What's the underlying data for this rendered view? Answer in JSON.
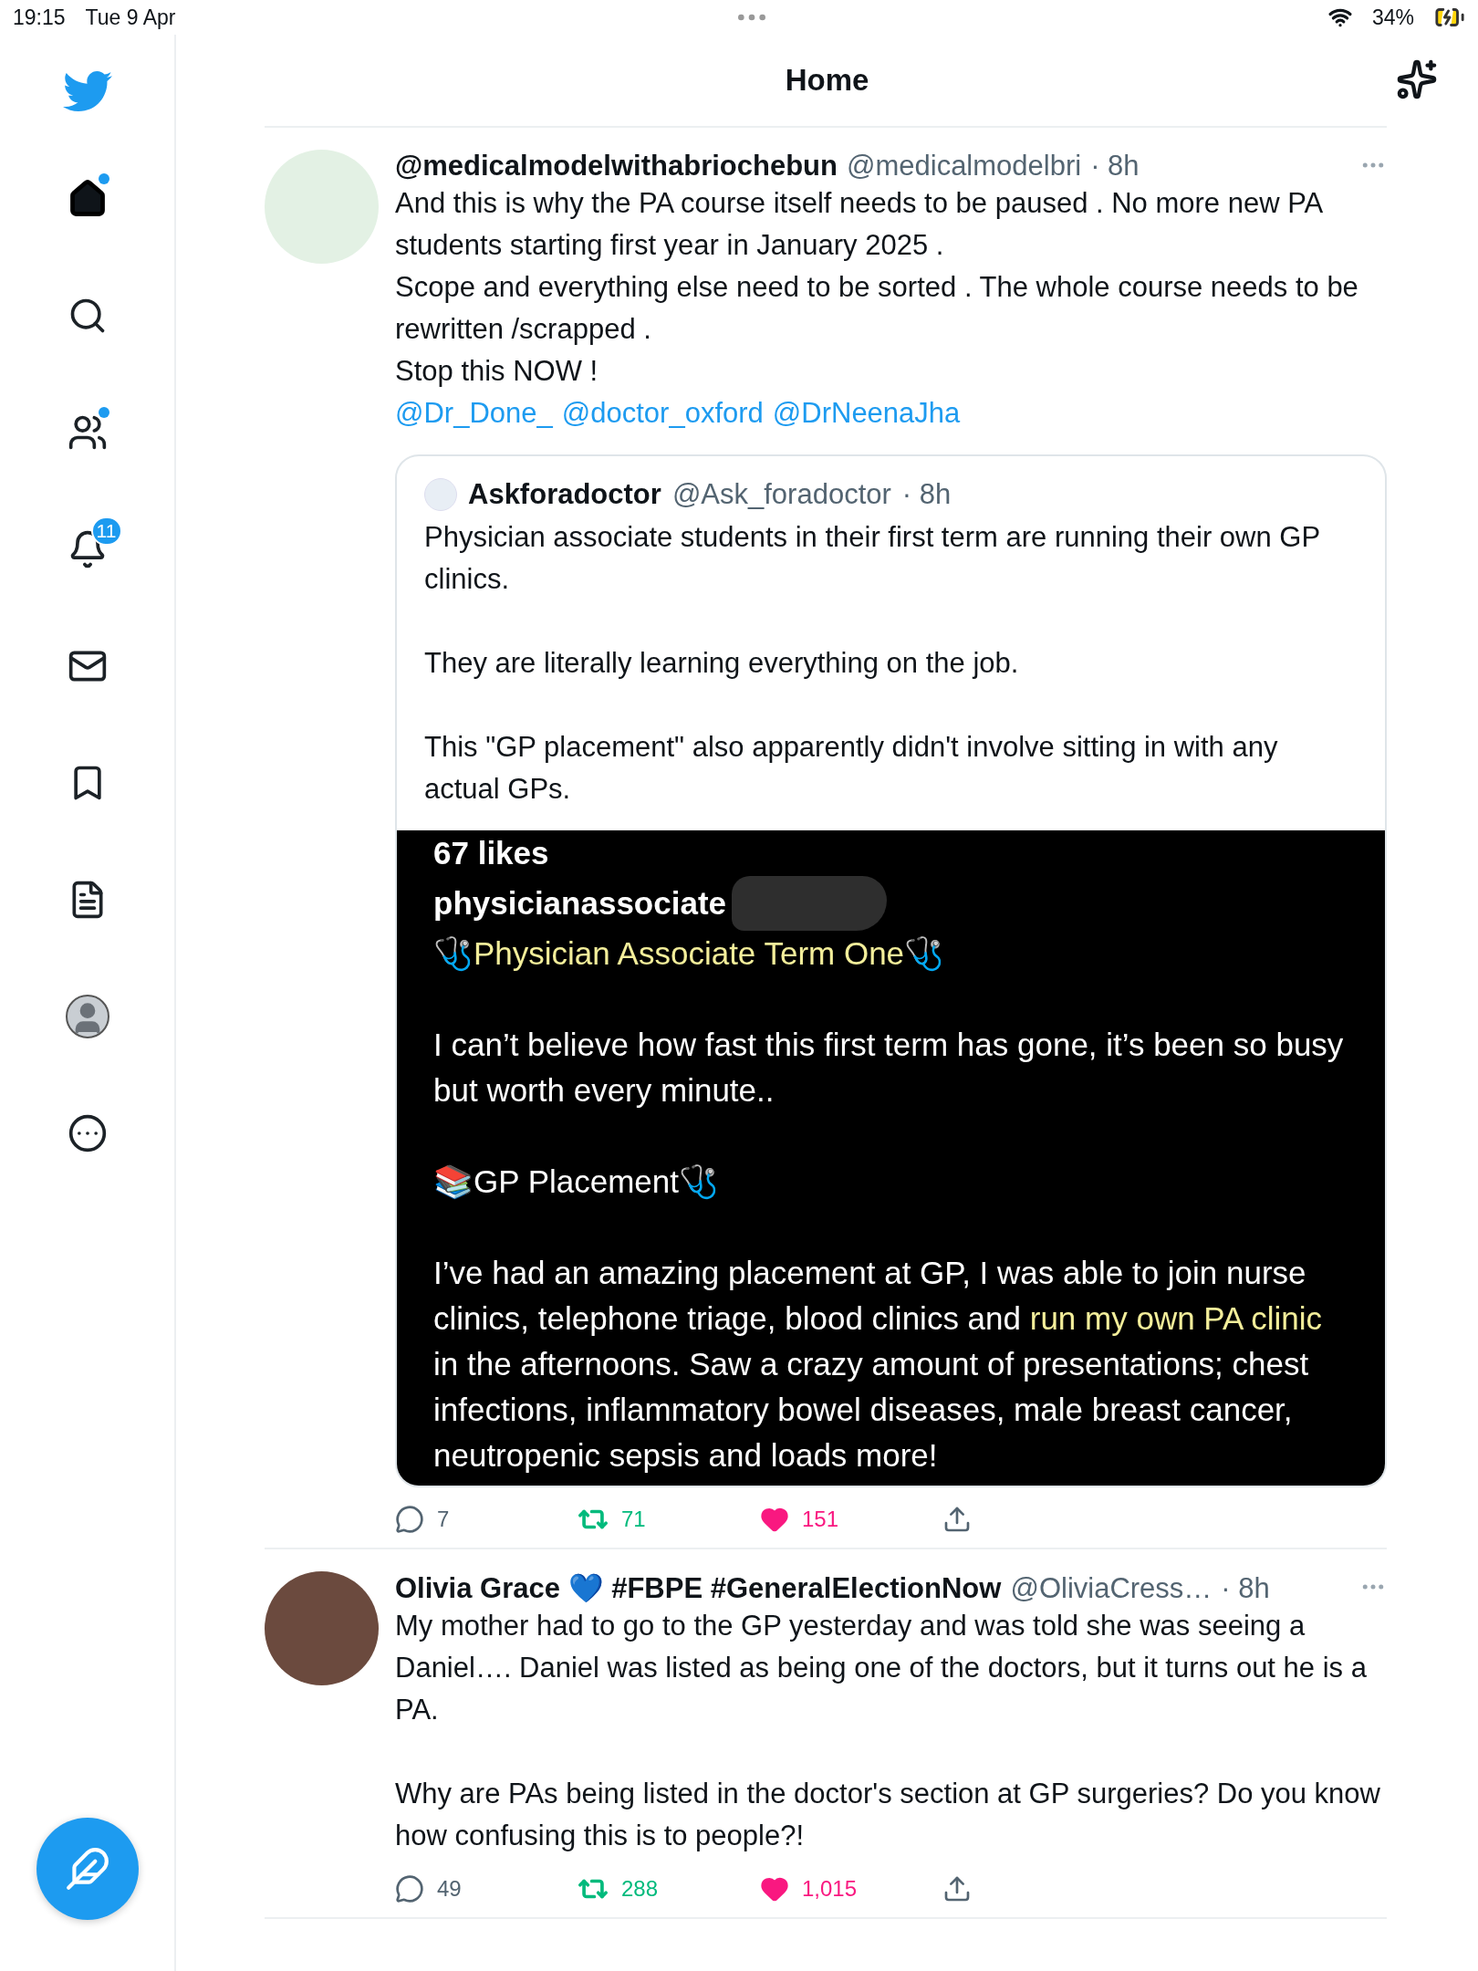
{
  "status_bar": {
    "time": "19:15",
    "date": "Tue 9 Apr",
    "battery": "34%"
  },
  "header": {
    "title": "Home"
  },
  "sidebar": {
    "items": [
      {
        "kind": "home",
        "selected": true,
        "dot": true
      },
      {
        "kind": "search",
        "selected": false,
        "dot": false
      },
      {
        "kind": "communities",
        "selected": false,
        "dot": true
      },
      {
        "kind": "notifications",
        "selected": false,
        "dot": false,
        "badge": "11"
      },
      {
        "kind": "messages",
        "selected": false,
        "dot": false
      },
      {
        "kind": "bookmarks",
        "selected": false,
        "dot": false
      },
      {
        "kind": "lists",
        "selected": false,
        "dot": false
      },
      {
        "kind": "profile",
        "selected": false,
        "dot": false
      },
      {
        "kind": "more",
        "selected": false,
        "dot": false
      }
    ]
  },
  "tweets": [
    {
      "name": "@medicalmodelwithabriochebun",
      "handle": "@medicalmodelbri",
      "time": "· 8h",
      "text": "And this is why the PA course itself needs to be paused . No more new PA students starting first year in January 2025 .\nScope and everything else need to be sorted . The whole course needs to be rewritten /scrapped .\nStop this NOW !",
      "mentions": [
        "@Dr_Done_",
        "@doctor_oxford",
        "@DrNeenaJha"
      ],
      "quote": {
        "name": "Askforadoctor",
        "handle": "@Ask_foradoctor",
        "time": "· 8h",
        "paragraphs": [
          "Physician associate students in their first term are running their own GP clinics.",
          "They are literally learning everything on the job.",
          "This \"GP placement\" also apparently didn't involve sitting in with any actual GPs."
        ],
        "screenshot": {
          "likes": "67 likes",
          "username": "physicianassociate",
          "caption": "🩺Physician Associate Term One🩺",
          "paragraphs": [
            [
              {
                "text": "I can’t believe how fast this first term has gone, it’s been so busy but worth every minute..",
                "highlight": false
              }
            ],
            [
              {
                "text": "📚GP Placement🩺",
                "highlight": false
              }
            ],
            [
              {
                "text": "I’ve had an amazing placement at GP, I was able to join nurse clinics, telephone triage, blood clinics and ",
                "highlight": false
              },
              {
                "text": "run my own PA clinic",
                "highlight": true
              },
              {
                "text": " in the afternoons. Saw a crazy amount of presentations; chest infections, inflammatory bowel diseases, male breast cancer, neutropenic sepsis and loads more!",
                "highlight": false
              }
            ]
          ]
        }
      },
      "replies": "7",
      "retweets": "71",
      "likes": "151",
      "retweeted": true,
      "liked": true
    },
    {
      "name": "Olivia Grace 💙 #FBPE #GeneralElectionNow",
      "handle": "@OliviaCress…",
      "time": "· 8h",
      "text": "My mother had to go to the GP yesterday and was told she was seeing a Daniel…. Daniel was listed as being one of the doctors, but it turns out he is a PA.\n\nWhy are PAs being listed in the doctor's section at GP surgeries? Do you know how confusing this is to people?!",
      "replies": "49",
      "retweets": "288",
      "likes": "1,015",
      "retweeted": true,
      "liked": true
    }
  ]
}
